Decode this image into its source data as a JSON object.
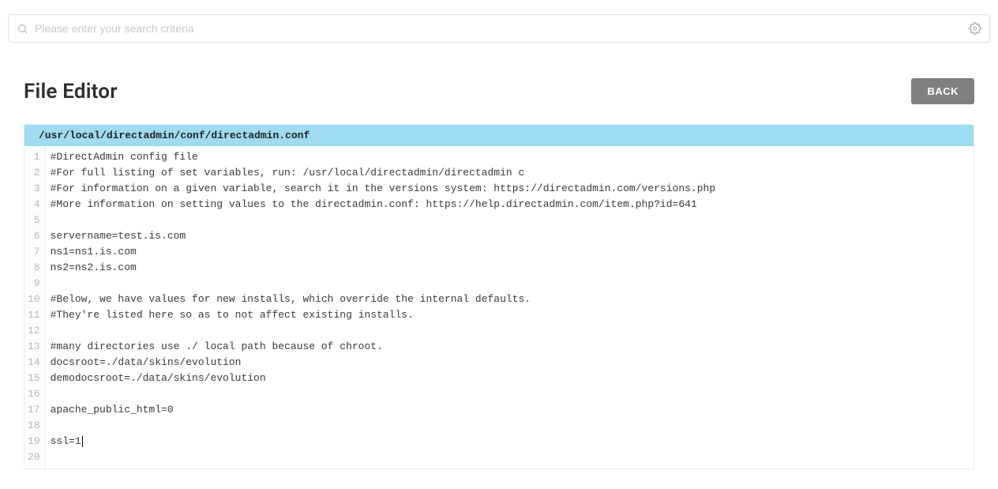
{
  "search": {
    "placeholder": "Please enter your search criteria"
  },
  "header": {
    "title": "File Editor",
    "back_label": "BACK"
  },
  "editor": {
    "file_path": "/usr/local/directadmin/conf/directadmin.conf",
    "cursor_line": 19,
    "lines": [
      "#DirectAdmin config file",
      "#For full listing of set variables, run: /usr/local/directadmin/directadmin c",
      "#For information on a given variable, search it in the versions system: https://directadmin.com/versions.php",
      "#More information on setting values to the directadmin.conf: https://help.directadmin.com/item.php?id=641",
      "",
      "servername=test.is.com",
      "ns1=ns1.is.com",
      "ns2=ns2.is.com",
      "",
      "#Below, we have values for new installs, which override the internal defaults.",
      "#They're listed here so as to not affect existing installs.",
      "",
      "#many directories use ./ local path because of chroot.",
      "docsroot=./data/skins/evolution",
      "demodocsroot=./data/skins/evolution",
      "",
      "apache_public_html=0",
      "",
      "ssl=1",
      ""
    ]
  }
}
